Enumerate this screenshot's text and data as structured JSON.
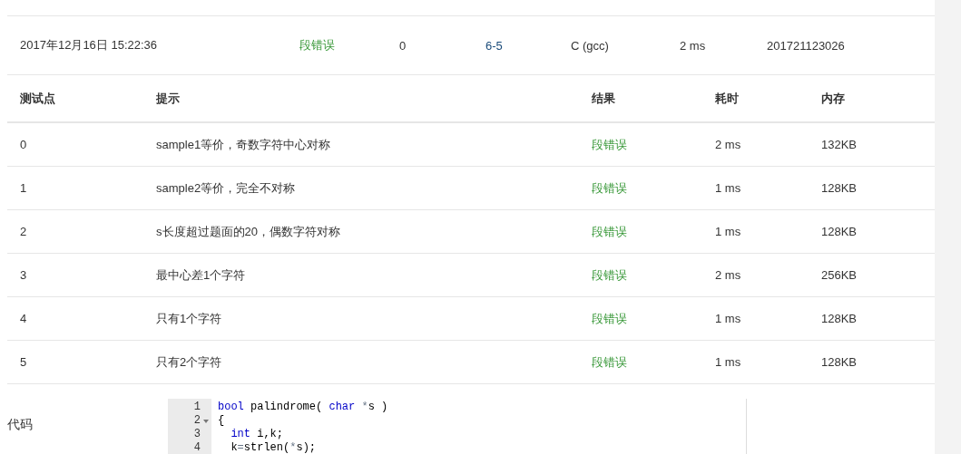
{
  "submission": {
    "time": "2017年12月16日 15:22:36",
    "result": "段错误",
    "score": "0",
    "problem": "6-5",
    "compiler": "C (gcc)",
    "duration": "2 ms",
    "user": "201721123026"
  },
  "cases": {
    "columns": [
      "测试点",
      "提示",
      "结果",
      "耗时",
      "内存"
    ],
    "rows": [
      {
        "id": "0",
        "hint": "sample1等价，奇数字符中心对称",
        "result": "段错误",
        "time": "2 ms",
        "memory": "132KB"
      },
      {
        "id": "1",
        "hint": "sample2等价，完全不对称",
        "result": "段错误",
        "time": "1 ms",
        "memory": "128KB"
      },
      {
        "id": "2",
        "hint": "s长度超过题面的20，偶数字符对称",
        "result": "段错误",
        "time": "1 ms",
        "memory": "128KB"
      },
      {
        "id": "3",
        "hint": "最中心差1个字符",
        "result": "段错误",
        "time": "2 ms",
        "memory": "256KB"
      },
      {
        "id": "4",
        "hint": "只有1个字符",
        "result": "段错误",
        "time": "1 ms",
        "memory": "128KB"
      },
      {
        "id": "5",
        "hint": "只有2个字符",
        "result": "段错误",
        "time": "1 ms",
        "memory": "128KB"
      }
    ]
  },
  "code": {
    "label": "代码",
    "lines": [
      {
        "number": "1",
        "foldable": false,
        "tokens": [
          {
            "kind": "keyword",
            "text": "bool"
          },
          {
            "kind": "plain",
            "text": " palindrome( "
          },
          {
            "kind": "keyword",
            "text": "char "
          },
          {
            "kind": "operator",
            "text": "*"
          },
          {
            "kind": "plain",
            "text": "s )"
          }
        ]
      },
      {
        "number": "2",
        "foldable": true,
        "tokens": [
          {
            "kind": "plain",
            "text": "{"
          }
        ]
      },
      {
        "number": "3",
        "foldable": false,
        "tokens": [
          {
            "kind": "keyword",
            "text": "  int"
          },
          {
            "kind": "plain",
            "text": " i,k;"
          }
        ]
      },
      {
        "number": "4",
        "foldable": false,
        "tokens": [
          {
            "kind": "plain",
            "text": "  k"
          },
          {
            "kind": "operator",
            "text": "="
          },
          {
            "kind": "plain",
            "text": "strlen("
          },
          {
            "kind": "operator",
            "text": "*"
          },
          {
            "kind": "plain",
            "text": "s);"
          }
        ]
      }
    ]
  }
}
